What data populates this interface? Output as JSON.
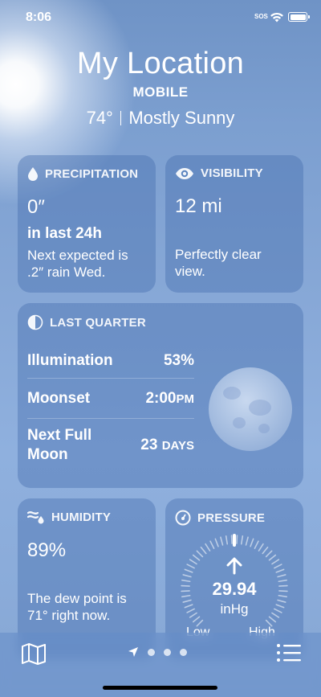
{
  "status_bar": {
    "time": "8:06",
    "sos": "SOS"
  },
  "header": {
    "location": "My Location",
    "city": "MOBILE",
    "temperature": "74°",
    "condition": "Mostly Sunny"
  },
  "precipitation": {
    "title": "PRECIPITATION",
    "amount": "0″",
    "period": "in last 24h",
    "note": "Next expected is .2″ rain Wed."
  },
  "visibility": {
    "title": "VISIBILITY",
    "distance": "12 mi",
    "note": "Perfectly clear view."
  },
  "moon": {
    "title": "LAST QUARTER",
    "rows": [
      {
        "label": "Illumination",
        "value": "53%"
      },
      {
        "label": "Moonset",
        "value": "2:00",
        "suffix": "PM"
      },
      {
        "label": "Next Full Moon",
        "value": "23",
        "suffix": "DAYS"
      }
    ]
  },
  "humidity": {
    "title": "HUMIDITY",
    "value": "89%",
    "note": "The dew point is 71° right now."
  },
  "pressure": {
    "title": "PRESSURE",
    "value": "29.94",
    "unit": "inHg",
    "low": "Low",
    "high": "High"
  },
  "icons": {
    "map": "map-icon",
    "location": "location-arrow-icon",
    "list": "list-icon"
  }
}
